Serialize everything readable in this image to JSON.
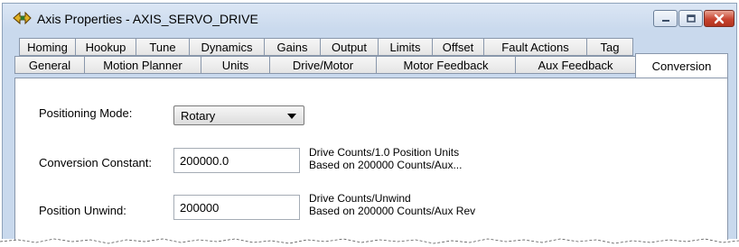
{
  "window": {
    "title": "Axis Properties - AXIS_SERVO_DRIVE",
    "app_icon": "axis-properties-icon",
    "controls": {
      "minimize": "minimize-icon",
      "maximize": "maximize-icon",
      "close": "close-icon"
    }
  },
  "tabs": {
    "row1": [
      "Homing",
      "Hookup",
      "Tune",
      "Dynamics",
      "Gains",
      "Output",
      "Limits",
      "Offset",
      "Fault Actions",
      "Tag"
    ],
    "row2": [
      "General",
      "Motion Planner",
      "Units",
      "Drive/Motor",
      "Motor Feedback",
      "Aux Feedback",
      "Conversion"
    ],
    "active": "Conversion"
  },
  "conversion": {
    "positioning_mode_label": "Positioning Mode:",
    "positioning_mode_value": "Rotary",
    "conversion_constant_label": "Conversion Constant:",
    "conversion_constant_value": "200000.0",
    "conversion_constant_desc_1": "Drive Counts/1.0 Position Units",
    "conversion_constant_desc_2": "Based on 200000 Counts/Aux...",
    "position_unwind_label": "Position Unwind:",
    "position_unwind_value": "200000",
    "position_unwind_desc_1": "Drive Counts/Unwind",
    "position_unwind_desc_2": "Based on 200000 Counts/Aux Rev"
  },
  "colors": {
    "title_bar": "#c9d9ed",
    "close_button": "#c8432f",
    "tab_border": "#8997ab"
  }
}
